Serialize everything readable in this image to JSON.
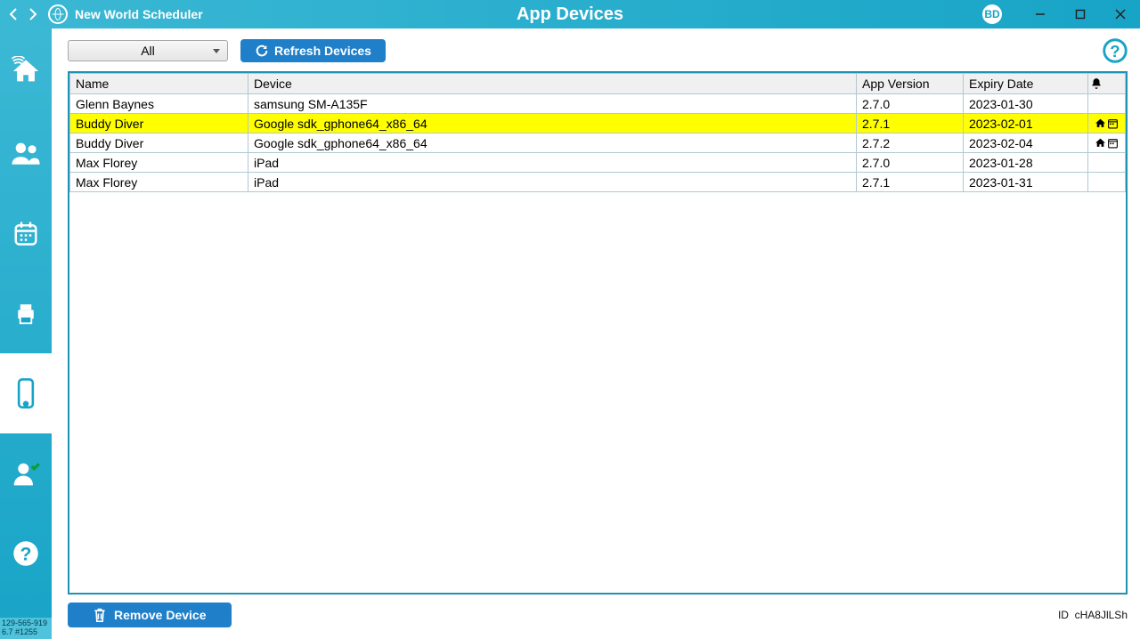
{
  "header": {
    "app_name": "New World Scheduler",
    "page_title": "App Devices",
    "avatar_initials": "BD"
  },
  "sidebar": {
    "footer_line1": "129-565-919",
    "footer_line2": "6.7 #1255"
  },
  "toolbar": {
    "filter_value": "All",
    "refresh_label": "Refresh Devices"
  },
  "table": {
    "headers": {
      "name": "Name",
      "device": "Device",
      "version": "App Version",
      "expiry": "Expiry Date"
    },
    "rows": [
      {
        "name": "Glenn Baynes",
        "device": "samsung SM-A135F",
        "version": "2.7.0",
        "expiry": "2023-01-30",
        "highlight": false,
        "icons": false
      },
      {
        "name": "Buddy Diver",
        "device": "Google sdk_gphone64_x86_64",
        "version": "2.7.1",
        "expiry": "2023-02-01",
        "highlight": true,
        "icons": true
      },
      {
        "name": "Buddy Diver",
        "device": "Google sdk_gphone64_x86_64",
        "version": "2.7.2",
        "expiry": "2023-02-04",
        "highlight": false,
        "icons": true
      },
      {
        "name": "Max Florey",
        "device": "iPad",
        "version": "2.7.0",
        "expiry": "2023-01-28",
        "highlight": false,
        "icons": false
      },
      {
        "name": "Max Florey",
        "device": "iPad",
        "version": "2.7.1",
        "expiry": "2023-01-31",
        "highlight": false,
        "icons": false
      }
    ]
  },
  "footer": {
    "remove_label": "Remove Device",
    "id_label": "ID",
    "id_value": "cHA8JlLSh"
  }
}
